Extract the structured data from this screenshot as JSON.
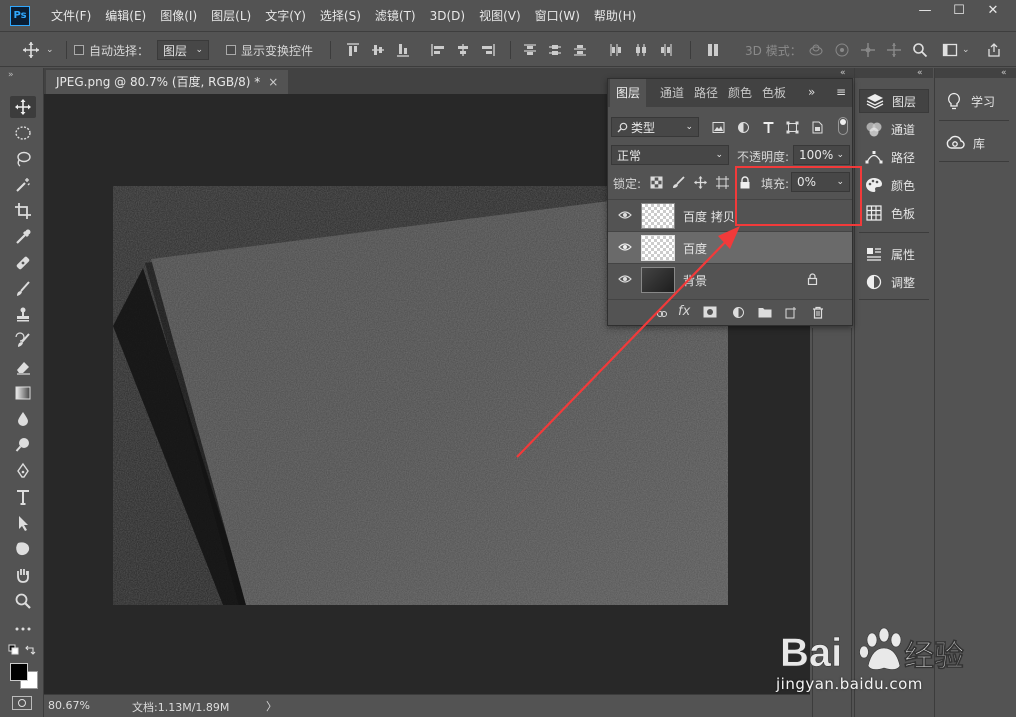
{
  "app": {
    "logo_text": "Ps"
  },
  "menu": [
    "文件(F)",
    "编辑(E)",
    "图像(I)",
    "图层(L)",
    "文字(Y)",
    "选择(S)",
    "滤镜(T)",
    "3D(D)",
    "视图(V)",
    "窗口(W)",
    "帮助(H)"
  ],
  "window_controls": {
    "minimize": "—",
    "maximize": "☐",
    "close": "✕"
  },
  "options": {
    "auto_select_label": "自动选择：",
    "auto_select_target": "图层",
    "show_transform_label": "显示变换控件",
    "mode_3d_label": "3D 模式："
  },
  "document": {
    "tab_title": "JPEG.png @ 80.7% (百度, RGB/8) *",
    "close_glyph": "×",
    "zoom": "80.67%",
    "doc_size": "文档:1.13M/1.89M",
    "status_chevron": "〉"
  },
  "layers_panel": {
    "tabs": [
      "图层",
      "通道",
      "路径",
      "颜色",
      "色板"
    ],
    "selected_tab": "图层",
    "overflow_glyph": "»",
    "menu_glyph": "≡",
    "filter_kind": "类型",
    "blend_mode": "正常",
    "opacity_label": "不透明度:",
    "opacity_value": "100%",
    "lock_label": "锁定:",
    "fill_label": "填充:",
    "fill_value": "0%",
    "fx_label": "fx",
    "layers": [
      {
        "name": "百度 拷贝",
        "type": "text",
        "selected": false,
        "locked": false
      },
      {
        "name": "百度",
        "type": "text",
        "selected": true,
        "locked": false
      },
      {
        "name": "背景",
        "type": "image",
        "selected": false,
        "locked": true
      }
    ]
  },
  "panel_strip": {
    "items": [
      "图层",
      "通道",
      "路径",
      "颜色",
      "色板",
      "属性",
      "调整"
    ],
    "selected": "图层"
  },
  "far_strip": {
    "items": [
      "学习",
      "库"
    ]
  },
  "watermark": {
    "brand": "Bai 经验",
    "url": "jingyan.baidu.com"
  },
  "colors": {
    "accent_red": "#f23a3a",
    "panel_bg": "#535353",
    "canvas_bg": "#282828"
  }
}
